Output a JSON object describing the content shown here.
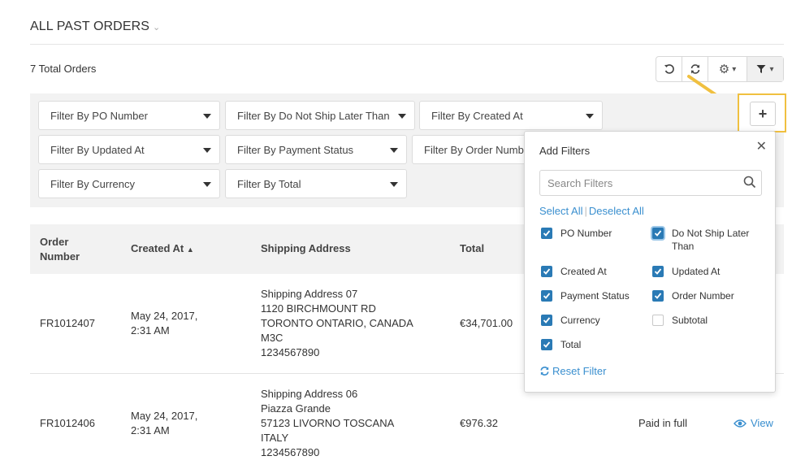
{
  "header": {
    "title": "ALL PAST ORDERS",
    "total": "7 Total Orders"
  },
  "toolbar": {
    "gear_caret": "▾",
    "filter_caret": "▾"
  },
  "filters": [
    "Filter By PO Number",
    "Filter By Do Not Ship Later Than",
    "Filter By Created At",
    "Filter By Updated At",
    "Filter By Payment Status",
    "Filter By Order Number",
    "Filter By Currency",
    "Filter By Total"
  ],
  "table": {
    "headers": {
      "order_number": "Order Number",
      "created_at": "Created At",
      "shipping_address": "Shipping Address",
      "total": "Total"
    },
    "rows": [
      {
        "order_number": "FR1012407",
        "created_at_1": "May 24, 2017,",
        "created_at_2": "2:31 AM",
        "address": [
          "Shipping Address 07",
          "1120 BIRCHMOUNT RD",
          "TORONTO ONTARIO, CANADA",
          "M3C",
          "1234567890"
        ],
        "total": "€34,701.00"
      },
      {
        "order_number": "FR1012406",
        "created_at_1": "May 24, 2017,",
        "created_at_2": "2:31 AM",
        "address": [
          "Shipping Address 06",
          "Piazza Grande",
          "57123 LIVORNO TOSCANA",
          "ITALY",
          "1234567890"
        ],
        "total": "€976.32",
        "payment_status": "Paid in full",
        "action": "View"
      }
    ]
  },
  "popup": {
    "title": "Add Filters",
    "search_placeholder": "Search Filters",
    "select_all": "Select All",
    "separator": "|",
    "deselect_all": "Deselect All",
    "options": [
      {
        "label": "PO Number",
        "checked": true
      },
      {
        "label": "Do Not Ship Later Than",
        "checked": true
      },
      {
        "label": "Created At",
        "checked": true
      },
      {
        "label": "Updated At",
        "checked": true
      },
      {
        "label": "Payment Status",
        "checked": true
      },
      {
        "label": "Order Number",
        "checked": true
      },
      {
        "label": "Currency",
        "checked": true
      },
      {
        "label": "Subtotal",
        "checked": false
      },
      {
        "label": "Total",
        "checked": true
      }
    ],
    "reset": "Reset Filter"
  },
  "colors": {
    "accent": "#2a7ab5",
    "link": "#3a8fcf",
    "highlight": "#f0c040"
  }
}
